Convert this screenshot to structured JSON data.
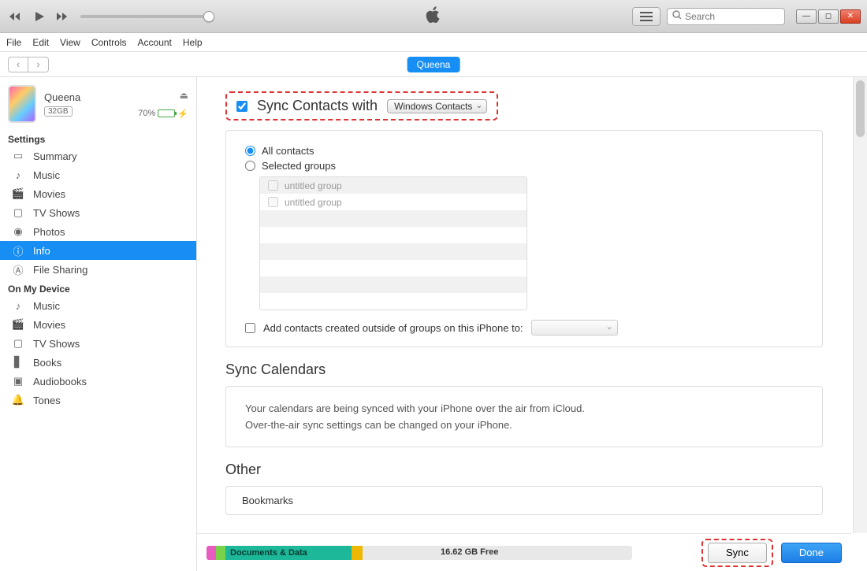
{
  "toolbar": {
    "search_placeholder": "Search"
  },
  "menus": [
    "File",
    "Edit",
    "View",
    "Controls",
    "Account",
    "Help"
  ],
  "nav": {
    "device_pill": "Queena"
  },
  "device": {
    "name": "Queena",
    "capacity": "32GB",
    "battery_pct": "70%"
  },
  "sidebar": {
    "settings_header": "Settings",
    "settings_items": [
      {
        "label": "Summary"
      },
      {
        "label": "Music"
      },
      {
        "label": "Movies"
      },
      {
        "label": "TV Shows"
      },
      {
        "label": "Photos"
      },
      {
        "label": "Info"
      },
      {
        "label": "File Sharing"
      }
    ],
    "device_header": "On My Device",
    "device_items": [
      {
        "label": "Music"
      },
      {
        "label": "Movies"
      },
      {
        "label": "TV Shows"
      },
      {
        "label": "Books"
      },
      {
        "label": "Audiobooks"
      },
      {
        "label": "Tones"
      }
    ]
  },
  "contacts": {
    "title": "Sync Contacts with",
    "provider": "Windows Contacts",
    "all_label": "All contacts",
    "selected_label": "Selected groups",
    "groups": [
      "untitled group",
      "untitled group"
    ],
    "outside_label": "Add contacts created outside of groups on this iPhone to:"
  },
  "calendars": {
    "title": "Sync Calendars",
    "line1": "Your calendars are being synced with your iPhone over the air from iCloud.",
    "line2": "Over-the-air sync settings can be changed on your iPhone."
  },
  "other": {
    "title": "Other",
    "bookmarks": "Bookmarks"
  },
  "bottom": {
    "docs_label": "Documents & Data",
    "free_label": "16.62 GB Free",
    "sync_label": "Sync",
    "done_label": "Done"
  }
}
